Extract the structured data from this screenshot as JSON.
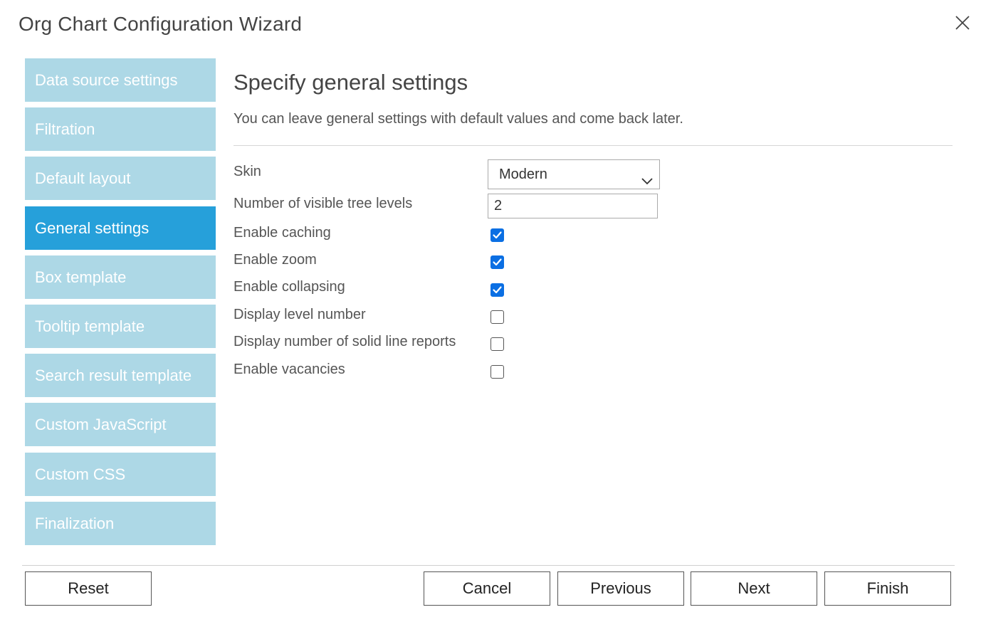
{
  "window": {
    "title": "Org Chart Configuration Wizard"
  },
  "sidebar": {
    "items": [
      {
        "label": "Data source settings"
      },
      {
        "label": "Filtration"
      },
      {
        "label": "Default layout"
      },
      {
        "label": "General settings"
      },
      {
        "label": "Box template"
      },
      {
        "label": "Tooltip template"
      },
      {
        "label": "Search result template"
      },
      {
        "label": "Custom JavaScript"
      },
      {
        "label": "Custom CSS"
      },
      {
        "label": "Finalization"
      }
    ],
    "active_label": "General settings"
  },
  "main": {
    "heading": "Specify general settings",
    "description": "You can leave general settings with default values and come back later.",
    "settings": {
      "skin": {
        "label": "Skin",
        "value": "Modern"
      },
      "visible_levels": {
        "label": "Number of visible tree levels",
        "value": "2"
      },
      "enable_caching": {
        "label": "Enable caching",
        "checked": true
      },
      "enable_zoom": {
        "label": "Enable zoom",
        "checked": true
      },
      "enable_collapsing": {
        "label": "Enable collapsing",
        "checked": true
      },
      "display_level_number": {
        "label": "Display level number",
        "checked": false
      },
      "display_solid_line_reports": {
        "label": "Display number of solid line reports",
        "checked": false
      },
      "enable_vacancies": {
        "label": "Enable vacancies",
        "checked": false
      }
    }
  },
  "footer": {
    "reset_label": "Reset",
    "cancel_label": "Cancel",
    "previous_label": "Previous",
    "next_label": "Next",
    "finish_label": "Finish"
  },
  "colors": {
    "nav_inactive": "#add8e6",
    "nav_active": "#26a0da",
    "checkbox_checked": "#0b6fe3"
  },
  "icons": {
    "close": "close-icon",
    "dropdown": "chevron-down-icon",
    "check": "checkmark-icon"
  }
}
